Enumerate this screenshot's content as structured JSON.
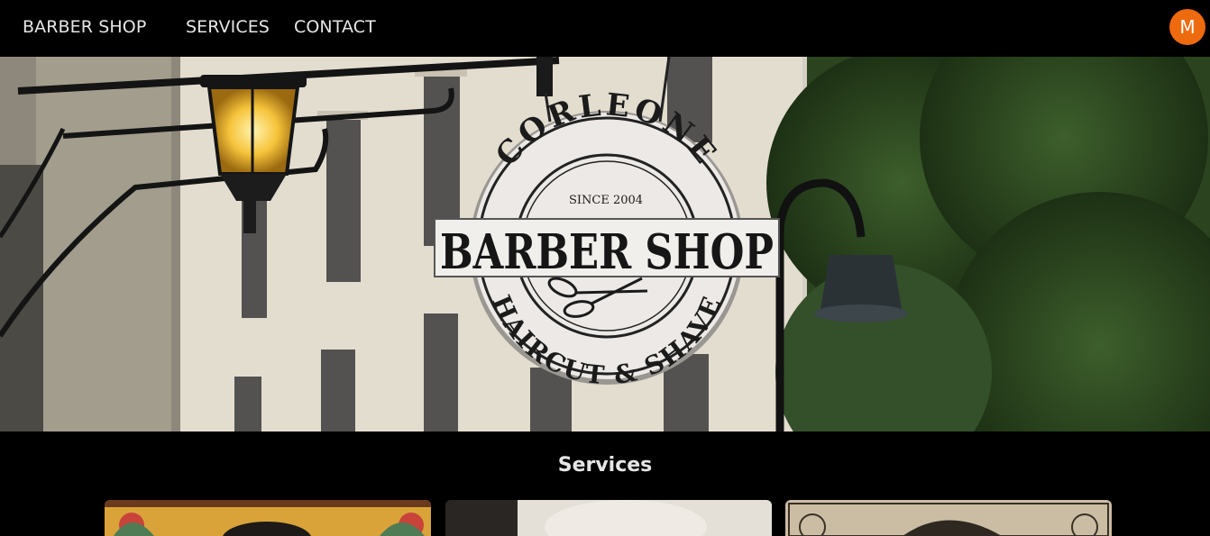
{
  "nav": {
    "brand": "BARBER SHOP",
    "links": [
      "SERVICES",
      "CONTACT"
    ],
    "avatar_initial": "M",
    "avatar_color": "#ee6a0f"
  },
  "hero": {
    "sign": {
      "arc_top": "CORLEONE",
      "since": "SINCE 2004",
      "main": "BARBER SHOP",
      "arc_bottom": "HAIRCUT & SHAVE",
      "icon": "scissors-icon"
    }
  },
  "services": {
    "heading": "Services",
    "cards": [
      {
        "image": "illustrated-portrait-image"
      },
      {
        "image": "salon-photo-image"
      },
      {
        "image": "engraved-portrait-image"
      }
    ]
  }
}
